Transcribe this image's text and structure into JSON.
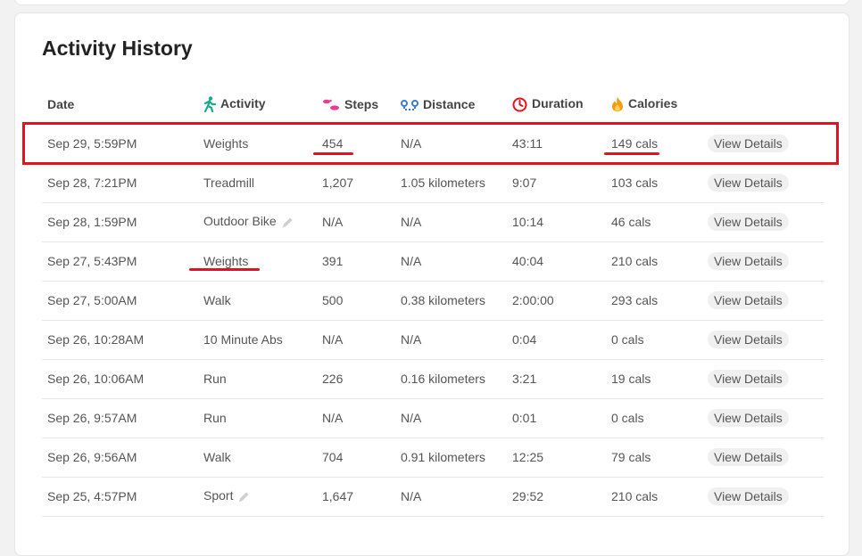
{
  "page": {
    "title": "Activity History"
  },
  "colors": {
    "accent_red": "#e0141e",
    "activity_icon": "#1aaa8d",
    "steps_icon": "#e83e8c",
    "distance_icon": "#3a7bd5",
    "duration_icon": "#e0141e",
    "calories_icon": "#f39c12"
  },
  "table": {
    "headers": {
      "date": "Date",
      "activity": "Activity",
      "steps": "Steps",
      "distance": "Distance",
      "duration": "Duration",
      "calories": "Calories"
    },
    "header_icons": {
      "activity": "walking-person-icon",
      "steps": "footprints-icon",
      "distance": "route-icon",
      "duration": "clock-icon",
      "calories": "flame-icon"
    },
    "rows": [
      {
        "date": "Sep 29, 5:59PM",
        "activity": "Weights",
        "steps": "454",
        "distance": "N/A",
        "duration": "43:11",
        "calories": "149 cals",
        "action": "View Details",
        "editable": false
      },
      {
        "date": "Sep 28, 7:21PM",
        "activity": "Treadmill",
        "steps": "1,207",
        "distance": "1.05 kilometers",
        "duration": "9:07",
        "calories": "103 cals",
        "action": "View Details",
        "editable": false
      },
      {
        "date": "Sep 28, 1:59PM",
        "activity": "Outdoor Bike",
        "steps": "N/A",
        "distance": "N/A",
        "duration": "10:14",
        "calories": "46 cals",
        "action": "View Details",
        "editable": true
      },
      {
        "date": "Sep 27, 5:43PM",
        "activity": "Weights",
        "steps": "391",
        "distance": "N/A",
        "duration": "40:04",
        "calories": "210 cals",
        "action": "View Details",
        "editable": false
      },
      {
        "date": "Sep 27, 5:00AM",
        "activity": "Walk",
        "steps": "500",
        "distance": "0.38 kilometers",
        "duration": "2:00:00",
        "calories": "293 cals",
        "action": "View Details",
        "editable": false
      },
      {
        "date": "Sep 26, 10:28AM",
        "activity": "10 Minute Abs",
        "steps": "N/A",
        "distance": "N/A",
        "duration": "0:04",
        "calories": "0 cals",
        "action": "View Details",
        "editable": false
      },
      {
        "date": "Sep 26, 10:06AM",
        "activity": "Run",
        "steps": "226",
        "distance": "0.16 kilometers",
        "duration": "3:21",
        "calories": "19 cals",
        "action": "View Details",
        "editable": false
      },
      {
        "date": "Sep 26, 9:57AM",
        "activity": "Run",
        "steps": "N/A",
        "distance": "N/A",
        "duration": "0:01",
        "calories": "0 cals",
        "action": "View Details",
        "editable": false
      },
      {
        "date": "Sep 26, 9:56AM",
        "activity": "Walk",
        "steps": "704",
        "distance": "0.91 kilometers",
        "duration": "12:25",
        "calories": "79 cals",
        "action": "View Details",
        "editable": false
      },
      {
        "date": "Sep 25, 4:57PM",
        "activity": "Sport",
        "steps": "1,647",
        "distance": "N/A",
        "duration": "29:52",
        "calories": "210 cals",
        "action": "View Details",
        "editable": true
      }
    ]
  }
}
